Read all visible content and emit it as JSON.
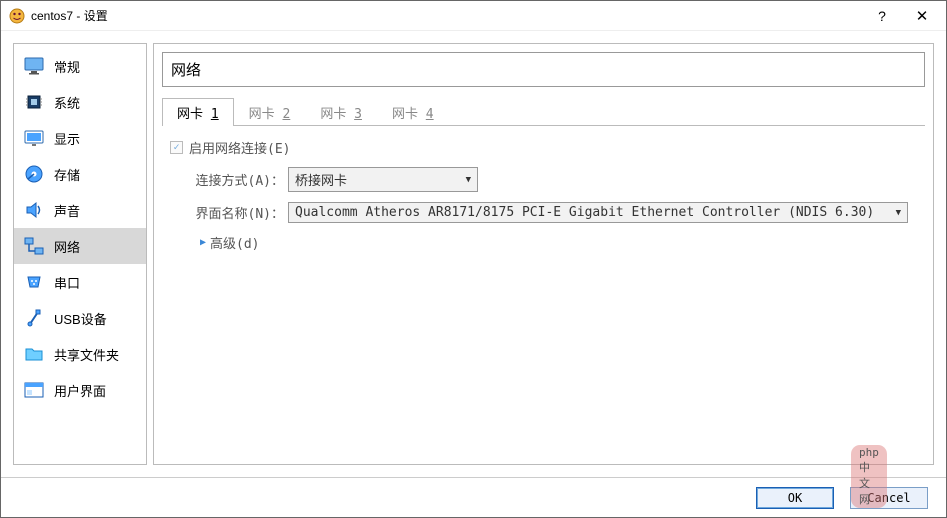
{
  "window": {
    "title": "centos7 - 设置"
  },
  "sidebar": {
    "items": [
      {
        "label": "常规"
      },
      {
        "label": "系统"
      },
      {
        "label": "显示"
      },
      {
        "label": "存储"
      },
      {
        "label": "声音"
      },
      {
        "label": "网络"
      },
      {
        "label": "串口"
      },
      {
        "label": "USB设备"
      },
      {
        "label": "共享文件夹"
      },
      {
        "label": "用户界面"
      }
    ],
    "active_index": 5
  },
  "content": {
    "header": "网络",
    "tabs": [
      {
        "prefix": "网卡 ",
        "num": "1"
      },
      {
        "prefix": "网卡 ",
        "num": "2"
      },
      {
        "prefix": "网卡 ",
        "num": "3"
      },
      {
        "prefix": "网卡 ",
        "num": "4"
      }
    ],
    "active_tab": 0,
    "enable_checkbox_label": "启用网络连接(E)",
    "enable_checked": true,
    "attached_label": "连接方式(A)：",
    "attached_value": "桥接网卡",
    "name_label": "界面名称(N)：",
    "name_value": "Qualcomm Atheros AR8171/8175 PCI-E Gigabit Ethernet Controller (NDIS 6.30)",
    "advanced_label": "高级(d)"
  },
  "footer": {
    "ok": "OK",
    "cancel": "Cancel"
  },
  "watermark": "php中文网"
}
